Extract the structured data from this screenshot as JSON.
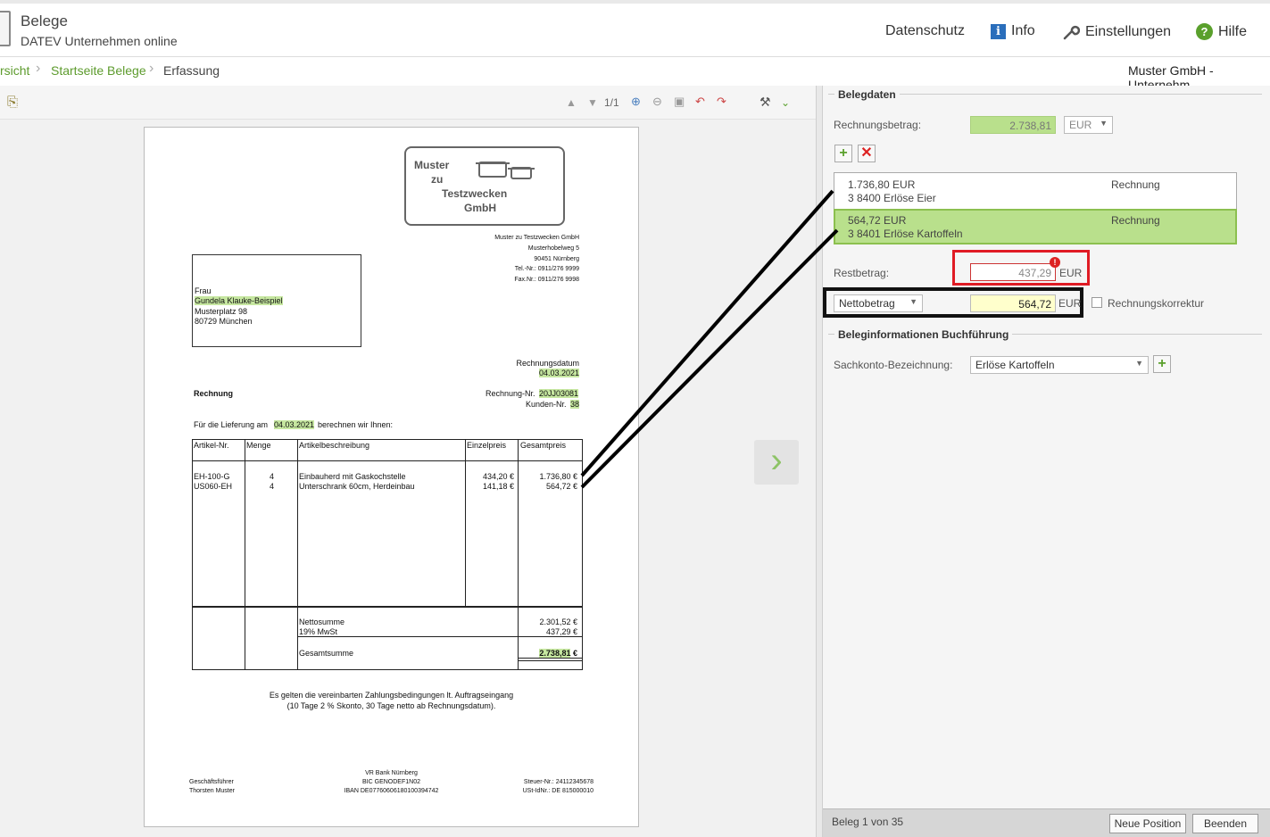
{
  "header": {
    "title": "Belege",
    "subtitle": "DATEV Unternehmen online",
    "nav": {
      "privacy": "Datenschutz",
      "info": "Info",
      "settings": "Einstellungen",
      "help": "Hilfe"
    }
  },
  "breadcrumb": {
    "first": "rsicht",
    "second": "Startseite Belege",
    "current": "Erfassung",
    "company": "Muster GmbH - Unternehm"
  },
  "viewer": {
    "page_counter": "1/1"
  },
  "invoice": {
    "logo": {
      "line1": "Muster",
      "line2": "zu",
      "line3": "Testzwecken",
      "line4": "GmbH"
    },
    "sender": [
      "Muster zu Testzwecken GmbH",
      "Musterhobelweg 5",
      "90451 Nürnberg",
      "Tel.-Nr.: 0911/276 9999",
      "Fax.Nr.: 0911/276 9998"
    ],
    "recipient": {
      "salutation": "Frau",
      "name": "Gundela Klauke-Beispiel",
      "street": "Musterplatz 98",
      "city": "80729 München"
    },
    "date_label": "Rechnungsdatum",
    "date_value": "04.03.2021",
    "doc_type": "Rechnung",
    "invoice_no_label": "Rechnung-Nr.",
    "invoice_no": "20JJ03081",
    "customer_no_label": "Kunden-Nr.",
    "customer_no": "38",
    "delivery_pre": "Für die Lieferung am",
    "delivery_date": "04.03.2021",
    "delivery_post": "berechnen wir Ihnen:",
    "columns": [
      "Artikel-Nr.",
      "Menge",
      "Artikelbeschreibung",
      "Einzelpreis",
      "Gesamtpreis"
    ],
    "rows": [
      {
        "art": "EH-100-G",
        "qty": "4",
        "desc": "Einbauherd mit Gaskochstelle",
        "unit": "434,20 €",
        "total": "1.736,80 €"
      },
      {
        "art": "US060-EH",
        "qty": "4",
        "desc": "Unterschrank 60cm, Herdeinbau",
        "unit": "141,18 €",
        "total": "564,72 €"
      }
    ],
    "net_label": "Nettosumme",
    "net_value": "2.301,52 €",
    "vat_label": "19% MwSt",
    "vat_value": "437,29 €",
    "gross_label": "Gesamtsumme",
    "gross_value": "2.738,81",
    "gross_currency": "€",
    "terms1": "Es gelten die vereinbarten Zahlungsbedingungen lt. Auftragseingang",
    "terms2": "(10 Tage 2 % Skonto, 30 Tage netto ab Rechnungsdatum).",
    "footer_left1": "Geschäftsführer",
    "footer_left2": "Thorsten Muster",
    "footer_mid1": "VR Bank Nürnberg",
    "footer_mid2": "BIC GENODEF1N02",
    "footer_mid3": "IBAN DE07760606180100394742",
    "footer_right1": "Steuer-Nr.: 24112345678",
    "footer_right2": "USt-IdNr.: DE 815000010"
  },
  "panel": {
    "section1": "Belegdaten",
    "amount_label": "Rechnungsbetrag:",
    "amount_value": "2.738,81",
    "currency": "EUR",
    "positions": [
      {
        "amount": "1.736,80 EUR",
        "account": "3 8400 Erlöse Eier",
        "type": "Rechnung"
      },
      {
        "amount": "564,72 EUR",
        "account": "3 8401 Erlöse Kartoffeln",
        "type": "Rechnung"
      }
    ],
    "rest_label": "Restbetrag:",
    "rest_value": "437,29",
    "rest_currency": "EUR",
    "net_select": "Nettobetrag",
    "net_value": "564,72",
    "net_currency": "EUR",
    "correction_label": "Rechnungskorrektur",
    "section2": "Beleginformationen Buchführung",
    "account_label": "Sachkonto-Bezeichnung:",
    "account_value": "Erlöse Kartoffeln",
    "footer_status": "Beleg 1 von 35",
    "btn_new": "Neue Position",
    "btn_end": "Beenden"
  },
  "colors": {
    "accent_green": "#5d9b2d",
    "highlight": "#c6e7a0",
    "error_red": "#e01b24"
  }
}
